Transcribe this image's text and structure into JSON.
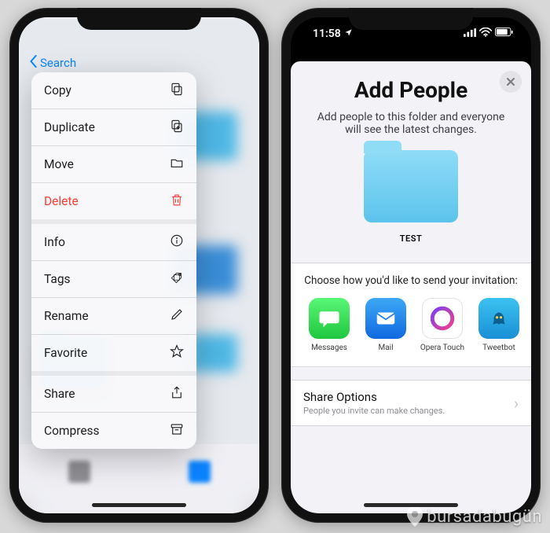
{
  "status": {
    "time": "11:58",
    "location_icon": "loc",
    "signal": "sig",
    "wifi": "wifi",
    "battery": "bat"
  },
  "left_phone": {
    "back_label": "Search",
    "menu": {
      "copy": "Copy",
      "duplicate": "Duplicate",
      "move": "Move",
      "delete": "Delete",
      "info": "Info",
      "tags": "Tags",
      "rename": "Rename",
      "favorite": "Favorite",
      "share": "Share",
      "compress": "Compress"
    }
  },
  "right_phone": {
    "title": "Add People",
    "description": "Add people to this folder and everyone will see the latest changes.",
    "folder_name": "TEST",
    "invite_prompt": "Choose how you'd like to send your invitation:",
    "apps": {
      "messages": "Messages",
      "mail": "Mail",
      "opera": "Opera Touch",
      "tweetbot": "Tweetbot"
    },
    "share_options": {
      "title": "Share Options",
      "subtitle": "People you invite can make changes."
    }
  },
  "watermark": "bursadabugün"
}
